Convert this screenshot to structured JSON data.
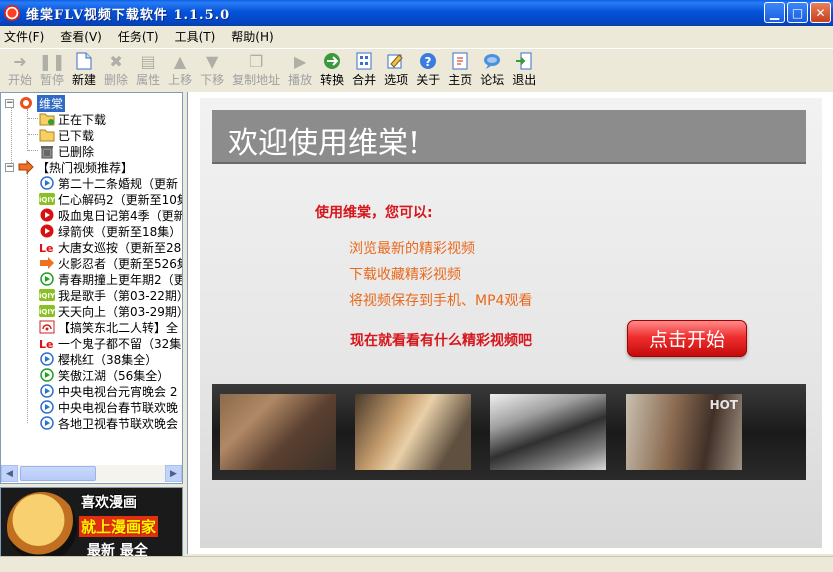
{
  "window": {
    "title": "维棠FLV视频下载软件 1.1.5.0"
  },
  "menu": [
    "文件(F)",
    "查看(V)",
    "任务(T)",
    "工具(T)",
    "帮助(H)"
  ],
  "toolbar": [
    {
      "label": "开始",
      "icon": "play-arrow-icon",
      "enabled": false
    },
    {
      "label": "暂停",
      "icon": "pause-icon",
      "enabled": false
    },
    {
      "label": "新建",
      "icon": "new-file-icon",
      "enabled": true
    },
    {
      "label": "删除",
      "icon": "delete-icon",
      "enabled": false
    },
    {
      "label": "属性",
      "icon": "properties-icon",
      "enabled": false
    },
    {
      "label": "上移",
      "icon": "move-up-icon",
      "enabled": false
    },
    {
      "label": "下移",
      "icon": "move-down-icon",
      "enabled": false
    },
    {
      "label": "复制地址",
      "icon": "copy-address-icon",
      "enabled": false
    },
    {
      "label": "播放",
      "icon": "play-file-icon",
      "enabled": false
    },
    {
      "label": "转换",
      "icon": "convert-icon",
      "enabled": true
    },
    {
      "label": "合并",
      "icon": "merge-icon",
      "enabled": true
    },
    {
      "label": "选项",
      "icon": "options-icon",
      "enabled": true
    },
    {
      "label": "关于",
      "icon": "about-icon",
      "enabled": true
    },
    {
      "label": "主页",
      "icon": "homepage-icon",
      "enabled": true
    },
    {
      "label": "论坛",
      "icon": "forum-icon",
      "enabled": true
    },
    {
      "label": "退出",
      "icon": "exit-icon",
      "enabled": true
    }
  ],
  "tree": {
    "root_label": "维棠",
    "downloads": [
      {
        "label": "正在下载",
        "icon": "downloading-folder-icon"
      },
      {
        "label": "已下载",
        "icon": "downloaded-folder-icon"
      },
      {
        "label": "已删除",
        "icon": "trash-icon"
      }
    ],
    "hot_label": "【热门视频推荐】",
    "hot_items": [
      {
        "label": "第二十二条婚规（更新",
        "icon": "blue-play-icon"
      },
      {
        "label": "仁心解码2（更新至10集",
        "icon": "iqiyi-icon"
      },
      {
        "label": "吸血鬼日记第4季（更新",
        "icon": "red-play-icon"
      },
      {
        "label": "绿箭侠（更新至18集）",
        "icon": "red-play-icon"
      },
      {
        "label": "大唐女巡按（更新至28",
        "icon": "letv-icon"
      },
      {
        "label": "火影忍者（更新至526集",
        "icon": "orange-arrow-icon"
      },
      {
        "label": "青春期撞上更年期2（更",
        "icon": "green-play-icon"
      },
      {
        "label": "我是歌手（第03-22期）",
        "icon": "iqiyi-icon"
      },
      {
        "label": "天天向上（第03-29期）",
        "icon": "iqiyi-icon"
      },
      {
        "label": "【搞笑东北二人转】全",
        "icon": "broadcast-icon"
      },
      {
        "label": "一个鬼子都不留（32集",
        "icon": "letv-icon"
      },
      {
        "label": "樱桃红（38集全）",
        "icon": "blue-play-icon"
      },
      {
        "label": "笑傲江湖（56集全）",
        "icon": "green-play-icon"
      },
      {
        "label": "中央电视台元宵晚会 2",
        "icon": "blue-play-icon"
      },
      {
        "label": "中央电视台春节联欢晚",
        "icon": "blue-play-icon"
      },
      {
        "label": "各地卫视春节联欢晚会",
        "icon": "blue-play-icon"
      }
    ]
  },
  "ad": {
    "line1": "喜欢漫画",
    "line2": "就上漫画家",
    "line3": "最新 最全"
  },
  "content": {
    "welcome": "欢迎使用维棠!",
    "intro": "使用维棠，您可以:",
    "features": [
      "浏览最新的精彩视频",
      "下载收藏精彩视频",
      "将视频保存到手机、MP4观看"
    ],
    "cta": "现在就看看有什么精彩视频吧",
    "start_button": "点击开始",
    "thumbnail_watermark": "HOT",
    "colors": {
      "intro_red": "#d6161c",
      "feature_orange": "#e8691c",
      "welcome_bar": "#8c8c8c"
    }
  }
}
